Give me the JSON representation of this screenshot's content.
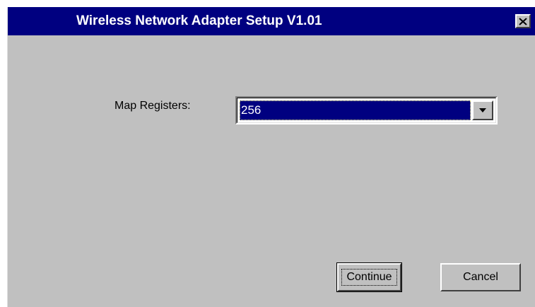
{
  "window": {
    "title": "Wireless Network Adapter Setup V1.01",
    "close_icon": "close-x-icon"
  },
  "form": {
    "map_registers": {
      "label": "Map Registers:",
      "selected_value": "256",
      "dropdown_icon": "chevron-down-icon"
    }
  },
  "buttons": {
    "continue_label": "Continue",
    "cancel_label": "Cancel"
  },
  "colors": {
    "titlebar": "#000080",
    "window_background": "#c0c0c0",
    "selection": "#000080"
  }
}
